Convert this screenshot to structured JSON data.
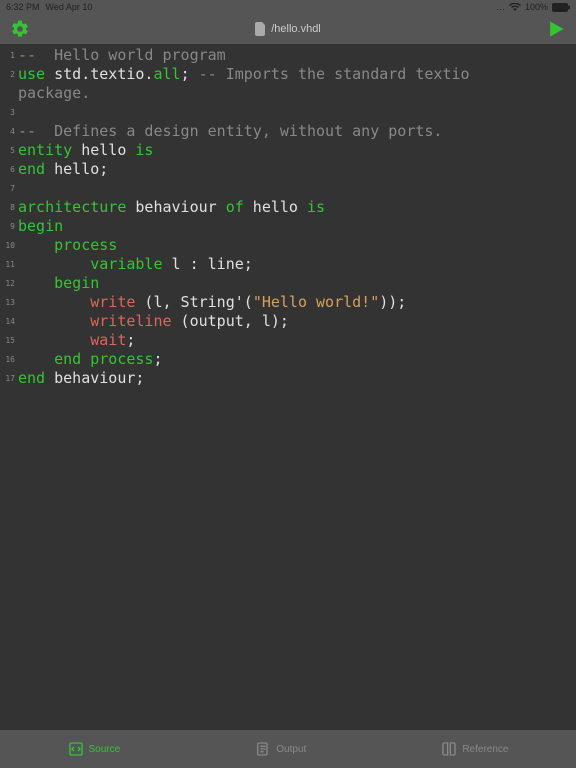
{
  "status": {
    "time": "6:32 PM",
    "date": "Wed Apr 10",
    "wifi": "…",
    "battery_pct": "100%"
  },
  "header": {
    "filename": "/hello.vhdl"
  },
  "code": {
    "lines": [
      [
        {
          "cls": "c-comment",
          "txt": "--  Hello world program"
        }
      ],
      [
        {
          "cls": "c-kw",
          "txt": "use"
        },
        {
          "cls": "c-ident",
          "txt": " std.textio."
        },
        {
          "cls": "c-kw",
          "txt": "all"
        },
        {
          "cls": "c-punc",
          "txt": "; "
        },
        {
          "cls": "c-comment",
          "txt": "-- Imports the standard textio package."
        }
      ],
      [],
      [
        {
          "cls": "c-comment",
          "txt": "--  Defines a design entity, without any ports."
        }
      ],
      [
        {
          "cls": "c-kw",
          "txt": "entity"
        },
        {
          "cls": "c-ident",
          "txt": " hello "
        },
        {
          "cls": "c-kw",
          "txt": "is"
        }
      ],
      [
        {
          "cls": "c-kw",
          "txt": "end"
        },
        {
          "cls": "c-ident",
          "txt": " hello"
        },
        {
          "cls": "c-punc",
          "txt": ";"
        }
      ],
      [],
      [
        {
          "cls": "c-kw",
          "txt": "architecture"
        },
        {
          "cls": "c-ident",
          "txt": " behaviour "
        },
        {
          "cls": "c-kw",
          "txt": "of"
        },
        {
          "cls": "c-ident",
          "txt": " hello "
        },
        {
          "cls": "c-kw",
          "txt": "is"
        }
      ],
      [
        {
          "cls": "c-kw",
          "txt": "begin"
        }
      ],
      [
        {
          "cls": "c-ident",
          "txt": "    "
        },
        {
          "cls": "c-kw",
          "txt": "process"
        }
      ],
      [
        {
          "cls": "c-ident",
          "txt": "        "
        },
        {
          "cls": "c-kw",
          "txt": "variable"
        },
        {
          "cls": "c-ident",
          "txt": " l "
        },
        {
          "cls": "c-punc",
          "txt": ": "
        },
        {
          "cls": "c-type",
          "txt": "line"
        },
        {
          "cls": "c-punc",
          "txt": ";"
        }
      ],
      [
        {
          "cls": "c-ident",
          "txt": "    "
        },
        {
          "cls": "c-kw",
          "txt": "begin"
        }
      ],
      [
        {
          "cls": "c-ident",
          "txt": "        "
        },
        {
          "cls": "c-func",
          "txt": "write"
        },
        {
          "cls": "c-punc",
          "txt": " (l, String'("
        },
        {
          "cls": "c-str",
          "txt": "\"Hello world!\""
        },
        {
          "cls": "c-punc",
          "txt": "));"
        }
      ],
      [
        {
          "cls": "c-ident",
          "txt": "        "
        },
        {
          "cls": "c-func",
          "txt": "writeline"
        },
        {
          "cls": "c-punc",
          "txt": " (output, l);"
        }
      ],
      [
        {
          "cls": "c-ident",
          "txt": "        "
        },
        {
          "cls": "c-func",
          "txt": "wait"
        },
        {
          "cls": "c-punc",
          "txt": ";"
        }
      ],
      [
        {
          "cls": "c-ident",
          "txt": "    "
        },
        {
          "cls": "c-kw",
          "txt": "end"
        },
        {
          "cls": "c-ident",
          "txt": " "
        },
        {
          "cls": "c-kw",
          "txt": "process"
        },
        {
          "cls": "c-punc",
          "txt": ";"
        }
      ],
      [
        {
          "cls": "c-kw",
          "txt": "end"
        },
        {
          "cls": "c-ident",
          "txt": " behaviour"
        },
        {
          "cls": "c-punc",
          "txt": ";"
        }
      ]
    ]
  },
  "tabs": {
    "source": "Source",
    "output": "Output",
    "reference": "Reference"
  }
}
